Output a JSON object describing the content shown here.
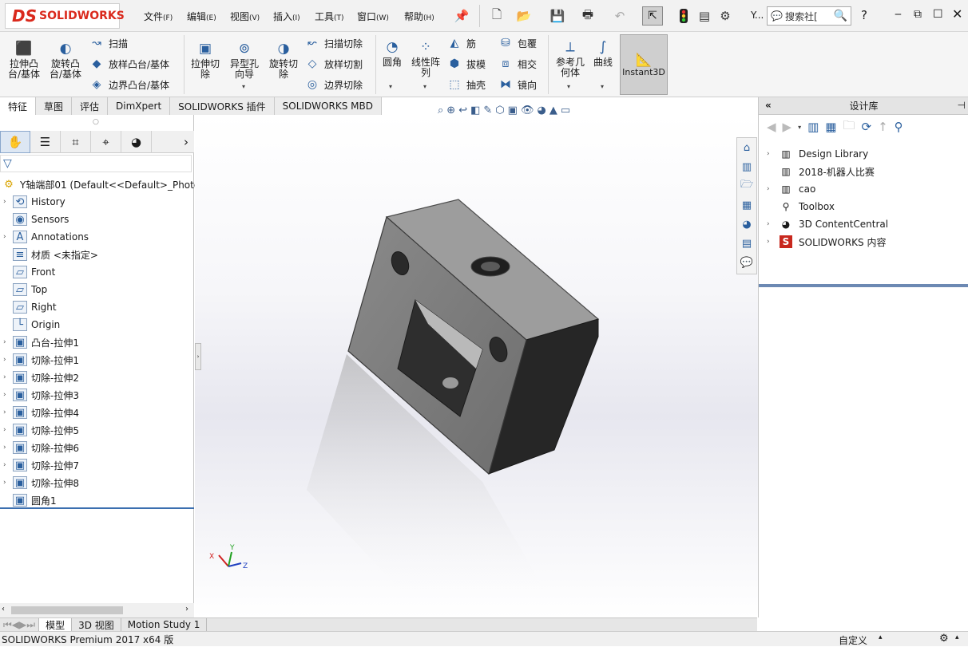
{
  "app": {
    "logo_mark": "DS",
    "logo_text": "SOLIDWORKS"
  },
  "menu": [
    {
      "label": "文件",
      "key": "(F)"
    },
    {
      "label": "编辑",
      "key": "(E)"
    },
    {
      "label": "视图",
      "key": "(V)"
    },
    {
      "label": "插入",
      "key": "(I)"
    },
    {
      "label": "工具",
      "key": "(T)"
    },
    {
      "label": "窗口",
      "key": "(W)"
    },
    {
      "label": "帮助",
      "key": "(H)"
    }
  ],
  "toolbar": {
    "user_short": "Y...",
    "search_placeholder": "搜索社[",
    "help": "?"
  },
  "ribbon": {
    "extrude_boss": "拉伸凸\n台/基体",
    "revolve_boss": "旋转凸\n台/基体",
    "sweep": "扫描",
    "loft_boss": "放样凸台/基体",
    "boundary_boss": "边界凸台/基体",
    "extrude_cut": "拉伸切\n除",
    "hole_wizard": "异型孔\n向导",
    "revolve_cut": "旋转切\n除",
    "swept_cut": "扫描切除",
    "lofted_cut": "放样切割",
    "boundary_cut": "边界切除",
    "fillet": "圆角",
    "linear_pattern": "线性阵\n列",
    "rib": "筋",
    "draft": "拔模",
    "shell": "抽壳",
    "wrap": "包覆",
    "intersect": "相交",
    "mirror": "镜向",
    "ref_geometry": "参考几\n何体",
    "curves": "曲线",
    "instant3d": "Instant3D"
  },
  "tabs": [
    "特征",
    "草图",
    "评估",
    "DimXpert",
    "SOLIDWORKS 插件",
    "SOLIDWORKS MBD"
  ],
  "feature_tree": {
    "root": "Y轴端部01  (Default<<Default>_Photo",
    "items": [
      {
        "label": "History",
        "exp": true
      },
      {
        "label": "Sensors",
        "exp": false
      },
      {
        "label": "Annotations",
        "exp": true
      },
      {
        "label": "材质 <未指定>",
        "exp": false
      },
      {
        "label": "Front",
        "exp": false
      },
      {
        "label": "Top",
        "exp": false
      },
      {
        "label": "Right",
        "exp": false
      },
      {
        "label": "Origin",
        "exp": false
      },
      {
        "label": "凸台-拉伸1",
        "exp": true
      },
      {
        "label": "切除-拉伸1",
        "exp": true
      },
      {
        "label": "切除-拉伸2",
        "exp": true
      },
      {
        "label": "切除-拉伸3",
        "exp": true
      },
      {
        "label": "切除-拉伸4",
        "exp": true
      },
      {
        "label": "切除-拉伸5",
        "exp": true
      },
      {
        "label": "切除-拉伸6",
        "exp": true
      },
      {
        "label": "切除-拉伸7",
        "exp": true
      },
      {
        "label": "切除-拉伸8",
        "exp": true
      },
      {
        "label": "圆角1",
        "exp": false
      }
    ]
  },
  "design_library": {
    "title": "设计库",
    "items": [
      {
        "label": "Design Library",
        "exp": true
      },
      {
        "label": "2018-机器人比赛",
        "exp": false
      },
      {
        "label": "cao",
        "exp": true
      },
      {
        "label": "Toolbox",
        "exp": false
      },
      {
        "label": "3D ContentCentral",
        "exp": true
      },
      {
        "label": "SOLIDWORKS 内容",
        "exp": true
      }
    ]
  },
  "bottom_tabs": [
    "模型",
    "3D 视图",
    "Motion Study 1"
  ],
  "status": {
    "left": "SOLIDWORKS Premium 2017 x64 版",
    "right": "自定义"
  },
  "colors": {
    "accent": "#da291c",
    "highlight": "#6c89b3"
  }
}
